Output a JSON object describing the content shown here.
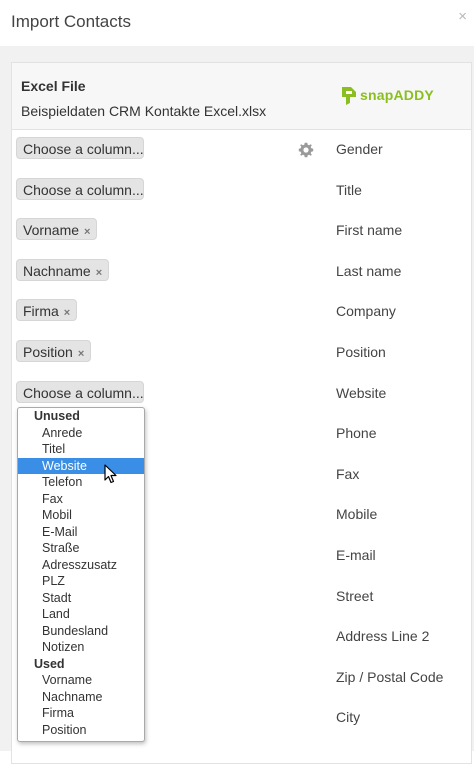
{
  "dialog": {
    "title": "Import Contacts",
    "close_icon": "×"
  },
  "file": {
    "label": "Excel File",
    "name": "Beispieldaten CRM Kontakte Excel.xlsx"
  },
  "logo": {
    "text": "snapADDY",
    "color": "#8bbf1f"
  },
  "rows": [
    {
      "selected": "Choose a column...",
      "placeholder": true,
      "field": "Gender"
    },
    {
      "selected": "Choose a column...",
      "placeholder": true,
      "field": "Title"
    },
    {
      "selected": "Vorname",
      "placeholder": false,
      "field": "First name"
    },
    {
      "selected": "Nachname",
      "placeholder": false,
      "field": "Last name"
    },
    {
      "selected": "Firma",
      "placeholder": false,
      "field": "Company"
    },
    {
      "selected": "Position",
      "placeholder": false,
      "field": "Position"
    },
    {
      "selected": "Choose a column...",
      "placeholder": true,
      "field": "Website"
    },
    {
      "field": "Phone"
    },
    {
      "field": "Fax"
    },
    {
      "field": "Mobile"
    },
    {
      "field": "E-mail"
    },
    {
      "field": "Street"
    },
    {
      "field": "Address Line 2"
    },
    {
      "field": "Zip / Postal Code"
    },
    {
      "field": "City"
    }
  ],
  "remove_icon": "×",
  "dropdown": {
    "groups": [
      {
        "label": "Unused",
        "options": [
          "Anrede",
          "Titel",
          "Website",
          "Telefon",
          "Fax",
          "Mobil",
          "E-Mail",
          "Straße",
          "Adresszusatz",
          "PLZ",
          "Stadt",
          "Land",
          "Bundesland",
          "Notizen"
        ]
      },
      {
        "label": "Used",
        "options": [
          "Vorname",
          "Nachname",
          "Firma",
          "Position"
        ]
      }
    ],
    "highlighted": "Website",
    "highlight_color": "#3a8ee6"
  }
}
